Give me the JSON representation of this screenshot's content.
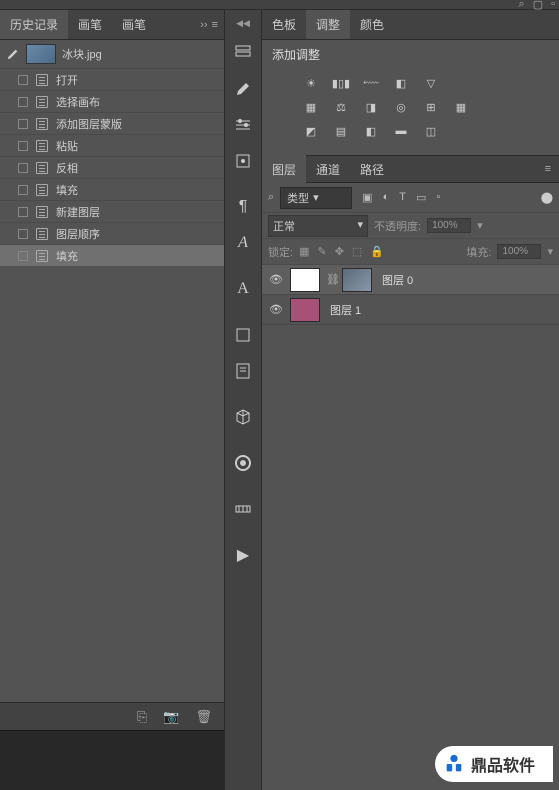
{
  "tabs": {
    "history": "历史记录",
    "brush1": "画笔",
    "brush2": "画笔"
  },
  "history": {
    "filename": "冰块.jpg",
    "items": [
      "打开",
      "选择画布",
      "添加图层蒙版",
      "粘贴",
      "反相",
      "填充",
      "新建图层",
      "图层顺序",
      "填充"
    ]
  },
  "right_tabs": {
    "swatches": "色板",
    "adjustments": "调整",
    "color": "颜色"
  },
  "adjust": {
    "title": "添加调整"
  },
  "layer_tabs": {
    "layers": "图层",
    "channels": "通道",
    "paths": "路径"
  },
  "layer_filter": {
    "label": "类型"
  },
  "blend": {
    "mode": "正常",
    "opacity_label": "不透明度:",
    "opacity_value": "100%",
    "lock_label": "锁定:",
    "fill_label": "填充:",
    "fill_value": "100%"
  },
  "layers": [
    {
      "name": "图层 0",
      "thumb": "white",
      "mask": true
    },
    {
      "name": "图层 1",
      "thumb": "pink",
      "mask": false
    }
  ],
  "watermark": "鼎品软件"
}
